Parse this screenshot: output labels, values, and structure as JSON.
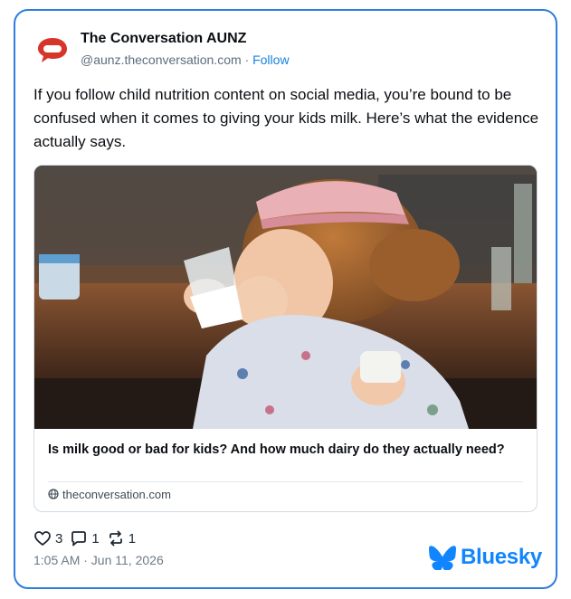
{
  "author": {
    "name": "The Conversation AUNZ",
    "handle": "@aunz.theconversation.com",
    "separator": " · ",
    "follow_label": "Follow"
  },
  "post": {
    "text": "If you follow child nutrition content on social media, you’re bound to be confused when it comes to giving your kids milk. Here’s what the evidence actually says."
  },
  "link_card": {
    "title": "Is milk good or bad for kids? And how much dairy do they actually need?",
    "domain": "theconversation.com",
    "image_alt": "young girl with pink cap drinking a glass of milk"
  },
  "stats": {
    "likes": "3",
    "replies": "1",
    "reposts": "1"
  },
  "timestamp": "1:05 AM · Jun 11, 2026",
  "brand": {
    "name": "Bluesky"
  },
  "colors": {
    "border": "#2f7de1",
    "link": "#1583e0",
    "brand": "#1185fe",
    "logo_red": "#d8352a"
  },
  "icons": {
    "avatar": "speech-bubble-logo",
    "like": "heart-icon",
    "reply": "comment-icon",
    "repost": "repost-icon",
    "globe": "globe-icon",
    "brand": "butterfly-icon"
  }
}
